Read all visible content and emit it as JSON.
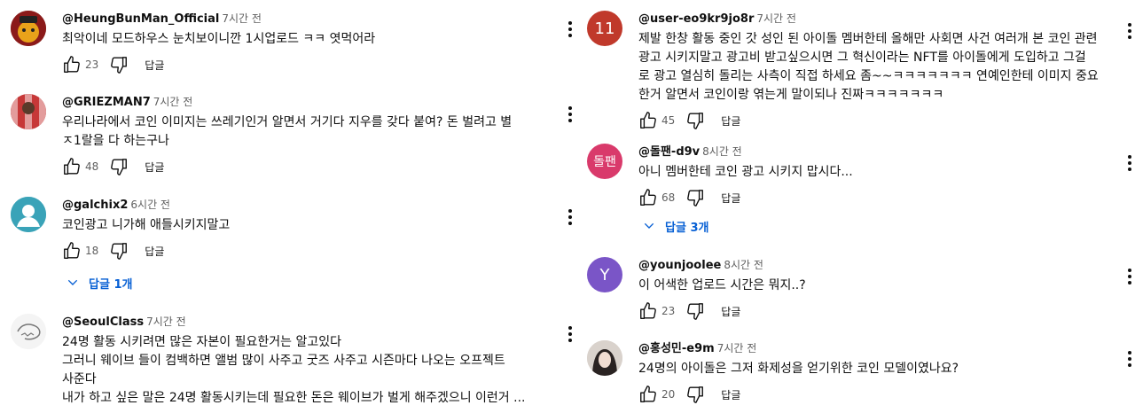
{
  "reply_label": "답글",
  "left": [
    {
      "author": "@HeungBunMan_Official",
      "time": "7시간 전",
      "lines": [
        "최악이네 모드하우스 눈치보이니깐 1시업로드 ㅋㅋ 엿먹어라"
      ],
      "likes": "23",
      "replies": ""
    },
    {
      "author": "@GRIEZMAN7",
      "time": "7시간 전",
      "lines": [
        "우리나라에서 코인 이미지는 쓰레기인거 알면서 거기다 지우를 갖다 붙여? 돈 벌려고 별",
        "ㅈ1랄을 다 하는구나"
      ],
      "likes": "48",
      "replies": ""
    },
    {
      "author": "@galchix2",
      "time": "6시간 전",
      "lines": [
        "코인광고 니가해 애들시키지말고"
      ],
      "likes": "18",
      "replies": "답글 1개"
    },
    {
      "author": "@SeoulClass",
      "time": "7시간 전",
      "lines": [
        "24명 활동 시키려면 많은 자본이 필요한거는 알고있다",
        "그러니 웨이브 들이 컴백하면 앨범 많이 사주고 굿즈 사주고 시즌마다 나오는 오프젝트",
        "사준다",
        "내가 하고 싶은 말은 24명 활동시키는데 필요한 돈은 웨이브가 벌게 해주겠으니 이런거 ..."
      ],
      "likes": "",
      "replies": ""
    }
  ],
  "right": [
    {
      "author": "@user-eo9kr9jo8r",
      "time": "7시간 전",
      "avatar_text": "11",
      "lines": [
        "제발 한창 활동 중인 갓 성인 된 아이돌 멤버한테 올해만 사회면 사건 여러개 본 코인 관련",
        "광고 시키지말고 광고비 받고싶으시면 그 혁신이라는 NFT를 아이돌에게 도입하고 그걸",
        "로 광고 열심히 돌리는 사측이 직접 하세요 좀~~ㅋㅋㅋㅋㅋㅋㅋ 연예인한테 이미지 중요",
        "한거 알면서 코인이랑 엮는게 말이되나 진짜ㅋㅋㅋㅋㅋㅋㅋ"
      ],
      "likes": "45",
      "replies": ""
    },
    {
      "author": "@돌팬-d9v",
      "time": "8시간 전",
      "avatar_text": "돌팬",
      "lines": [
        "아니 멤버한테 코인 광고 시키지 맙시다..."
      ],
      "likes": "68",
      "replies": "답글 3개"
    },
    {
      "author": "@younjoolee",
      "time": "8시간 전",
      "avatar_text": "Y",
      "lines": [
        "이 어색한 업로드 시간은 뭐지..?"
      ],
      "likes": "23",
      "replies": ""
    },
    {
      "author": "@홍성민-e9m",
      "time": "7시간 전",
      "avatar_text": "",
      "lines": [
        "24명의 아이돌은 그저 화제성을 얻기위한 코인 모델이였나요?"
      ],
      "likes": "20",
      "replies": ""
    }
  ],
  "colors": {
    "link": "#065fd4",
    "avatar_11": "#c0392b",
    "avatar_dol": "#d93a6b",
    "avatar_y": "#7a55c7",
    "avatar_gal": "#3aa3b8"
  },
  "icons": [
    "like-icon",
    "dislike-icon",
    "more-vert-icon",
    "chevron-down-icon"
  ]
}
